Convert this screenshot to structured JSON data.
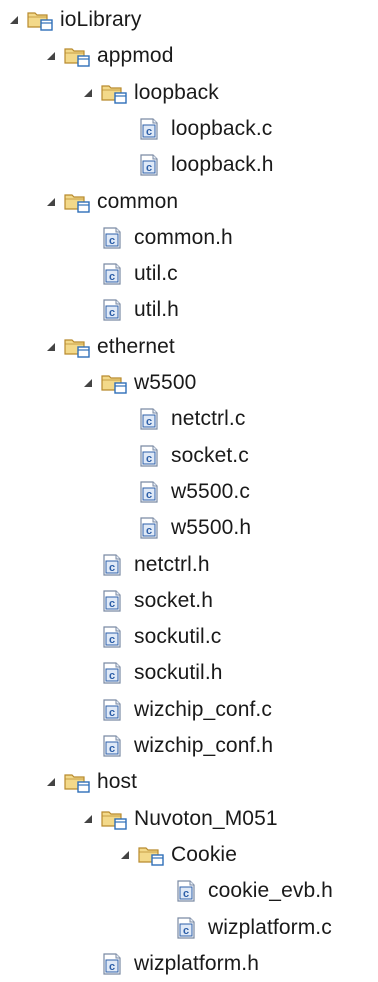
{
  "tree": {
    "colors": {
      "text": "#1a1a1a",
      "arrow": "#444444",
      "folder_fill": "#f3d98a",
      "folder_stroke": "#b88a2e",
      "package_blue": "#2f6fb8",
      "file_c": "#2d5fa8"
    },
    "rows": [
      {
        "id": "ioLibrary",
        "label": "ioLibrary",
        "type": "folder",
        "expanded": true,
        "depth": 0
      },
      {
        "id": "appmod",
        "label": "appmod",
        "type": "folder",
        "expanded": true,
        "depth": 1
      },
      {
        "id": "loopback",
        "label": "loopback",
        "type": "folder",
        "expanded": true,
        "depth": 2
      },
      {
        "id": "loopback-c",
        "label": "loopback.c",
        "type": "file",
        "icon": "c",
        "depth": 3
      },
      {
        "id": "loopback-h",
        "label": "loopback.h",
        "type": "file",
        "icon": "c",
        "depth": 3
      },
      {
        "id": "common",
        "label": "common",
        "type": "folder",
        "expanded": true,
        "depth": 1
      },
      {
        "id": "common-h",
        "label": "common.h",
        "type": "file",
        "icon": "c",
        "depth": 2
      },
      {
        "id": "util-c",
        "label": "util.c",
        "type": "file",
        "icon": "c",
        "depth": 2
      },
      {
        "id": "util-h",
        "label": "util.h",
        "type": "file",
        "icon": "c",
        "depth": 2
      },
      {
        "id": "ethernet",
        "label": "ethernet",
        "type": "folder",
        "expanded": true,
        "depth": 1
      },
      {
        "id": "w5500",
        "label": "w5500",
        "type": "folder",
        "expanded": true,
        "depth": 2
      },
      {
        "id": "netctrl-c",
        "label": "netctrl.c",
        "type": "file",
        "icon": "c",
        "depth": 3
      },
      {
        "id": "socket-c",
        "label": "socket.c",
        "type": "file",
        "icon": "c",
        "depth": 3
      },
      {
        "id": "w5500-c",
        "label": "w5500.c",
        "type": "file",
        "icon": "c",
        "depth": 3
      },
      {
        "id": "w5500-h",
        "label": "w5500.h",
        "type": "file",
        "icon": "c",
        "depth": 3
      },
      {
        "id": "netctrl-h",
        "label": "netctrl.h",
        "type": "file",
        "icon": "c",
        "depth": 2
      },
      {
        "id": "socket-h",
        "label": "socket.h",
        "type": "file",
        "icon": "c",
        "depth": 2
      },
      {
        "id": "sockutil-c",
        "label": "sockutil.c",
        "type": "file",
        "icon": "c",
        "depth": 2
      },
      {
        "id": "sockutil-h",
        "label": "sockutil.h",
        "type": "file",
        "icon": "c",
        "depth": 2
      },
      {
        "id": "wizchip-conf-c",
        "label": "wizchip_conf.c",
        "type": "file",
        "icon": "c",
        "depth": 2
      },
      {
        "id": "wizchip-conf-h",
        "label": "wizchip_conf.h",
        "type": "file",
        "icon": "c",
        "depth": 2
      },
      {
        "id": "host",
        "label": "host",
        "type": "folder",
        "expanded": true,
        "depth": 1
      },
      {
        "id": "nuvoton-m051",
        "label": "Nuvoton_M051",
        "type": "folder",
        "expanded": true,
        "depth": 2
      },
      {
        "id": "cookie",
        "label": "Cookie",
        "type": "folder",
        "expanded": true,
        "depth": 3
      },
      {
        "id": "cookie-evb-h",
        "label": "cookie_evb.h",
        "type": "file",
        "icon": "c",
        "depth": 4
      },
      {
        "id": "wizplatform-c",
        "label": "wizplatform.c",
        "type": "file",
        "icon": "c",
        "depth": 4
      },
      {
        "id": "wizplatform-h",
        "label": "wizplatform.h",
        "type": "file",
        "icon": "c",
        "depth": 2
      }
    ]
  }
}
